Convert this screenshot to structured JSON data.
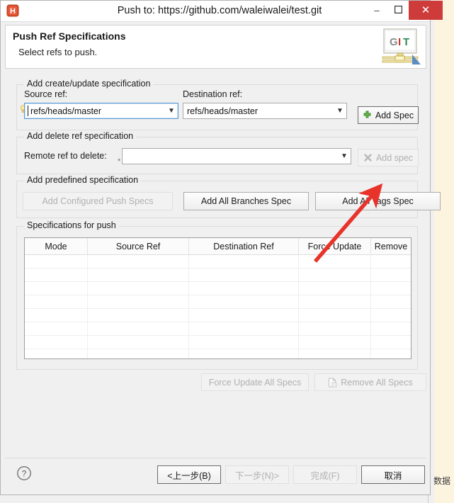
{
  "window": {
    "title": "Push to: https://github.com/waleiwalei/test.git",
    "app_icon": "h-app-icon",
    "minimize_label": "–",
    "maximize_label": "❑",
    "close_label": "✕",
    "close_color": "#cd3b3b"
  },
  "header": {
    "title": "Push Ref Specifications",
    "subtitle": "Select refs to push.",
    "logo": "git-logo",
    "logo_letters": [
      "G",
      "I",
      "T"
    ],
    "logo_colors": [
      "#8a8a8a",
      "#c0392b",
      "#2e8b57"
    ]
  },
  "create_group": {
    "legend": "Add create/update specification",
    "source_label": "Source ref:",
    "source_value": "refs/heads/master",
    "destination_label": "Destination ref:",
    "destination_value": "refs/heads/master",
    "add_spec_label": "Add Spec",
    "add_spec_icon": "green-plus-icon"
  },
  "delete_group": {
    "legend": "Add delete ref specification",
    "remote_label": "Remote ref to delete:",
    "remote_value": "",
    "remote_placeholder": "",
    "add_spec_label": "Add spec",
    "add_spec_icon": "gray-x-icon",
    "add_spec_enabled": false
  },
  "predefined_group": {
    "legend": "Add predefined specification",
    "buttons": [
      {
        "label": "Add Configured Push Specs",
        "enabled": false
      },
      {
        "label": "Add All Branches Spec",
        "enabled": true
      },
      {
        "label": "Add All Tags Spec",
        "enabled": true
      }
    ]
  },
  "specs_group": {
    "legend": "Specifications for push",
    "columns": [
      "Mode",
      "Source Ref",
      "Destination Ref",
      "Force Update",
      "Remove"
    ],
    "rows": [],
    "empty_row_count": 8,
    "force_update_all_label": "Force Update All Specs",
    "force_update_all_enabled": false,
    "remove_all_label": "Remove All Specs",
    "remove_all_icon": "remove-document-icon",
    "remove_all_enabled": false
  },
  "footer": {
    "help_icon": "question-mark-icon",
    "buttons": [
      {
        "label": "<上一步(B)",
        "enabled": true
      },
      {
        "label": "下一步(N)>",
        "enabled": false
      },
      {
        "label": "完成(F)",
        "enabled": false
      },
      {
        "label": "取消",
        "enabled": true
      }
    ]
  },
  "annotation": {
    "arrow_color": "#e8332a",
    "points_to": "Add Spec"
  },
  "background": {
    "partial_text": "数据"
  }
}
